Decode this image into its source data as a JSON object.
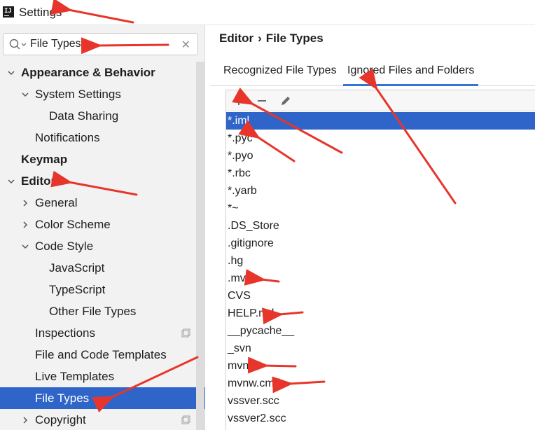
{
  "window": {
    "title": "Settings",
    "app_icon_text": "IJ"
  },
  "search": {
    "value": "File Types",
    "clear_symbol": "✕"
  },
  "sidebar": {
    "items": [
      {
        "label": "Appearance & Behavior",
        "level": 0,
        "bold": true,
        "expanded": true
      },
      {
        "label": "System Settings",
        "level": 1,
        "bold": false,
        "expanded": true
      },
      {
        "label": "Data Sharing",
        "level": 2,
        "bold": false
      },
      {
        "label": "Notifications",
        "level": 1,
        "bold": false
      },
      {
        "label": "Keymap",
        "level": 0,
        "bold": true
      },
      {
        "label": "Editor",
        "level": 0,
        "bold": true,
        "expanded": true
      },
      {
        "label": "General",
        "level": 1,
        "bold": false,
        "expanded": false
      },
      {
        "label": "Color Scheme",
        "level": 1,
        "bold": false,
        "expanded": false
      },
      {
        "label": "Code Style",
        "level": 1,
        "bold": false,
        "expanded": true
      },
      {
        "label": "JavaScript",
        "level": 2,
        "bold": false
      },
      {
        "label": "TypeScript",
        "level": 2,
        "bold": false
      },
      {
        "label": "Other File Types",
        "level": 2,
        "bold": false
      },
      {
        "label": "Inspections",
        "level": 1,
        "bold": false,
        "project_icon": true
      },
      {
        "label": "File and Code Templates",
        "level": 1,
        "bold": false
      },
      {
        "label": "Live Templates",
        "level": 1,
        "bold": false
      },
      {
        "label": "File Types",
        "level": 1,
        "bold": false,
        "selected": true
      },
      {
        "label": "Copyright",
        "level": 1,
        "bold": false,
        "expanded": false,
        "project_icon": true
      }
    ]
  },
  "breadcrumb": {
    "parent": "Editor",
    "separator": "›",
    "current": "File Types"
  },
  "tabs": [
    {
      "label": "Recognized File Types",
      "active": false
    },
    {
      "label": "Ignored Files and Folders",
      "active": true
    }
  ],
  "toolbar": {
    "add_icon": "plus-icon",
    "remove_icon": "minus-icon",
    "edit_icon": "pencil-icon"
  },
  "ignored_list": [
    "*.iml",
    "*.pyc",
    "*.pyo",
    "*.rbc",
    "*.yarb",
    "*~",
    ".DS_Store",
    ".gitignore",
    ".hg",
    ".mvn",
    "CVS",
    "HELP.md",
    "__pycache__",
    "_svn",
    "mvnw",
    "mvnw.cmd",
    "vssver.scc",
    "vssver2.scc"
  ],
  "selected_row": 0,
  "colors": {
    "selection": "#2f65c9",
    "tab_underline": "#3574d0",
    "annotation_arrow": "#e8352b"
  }
}
